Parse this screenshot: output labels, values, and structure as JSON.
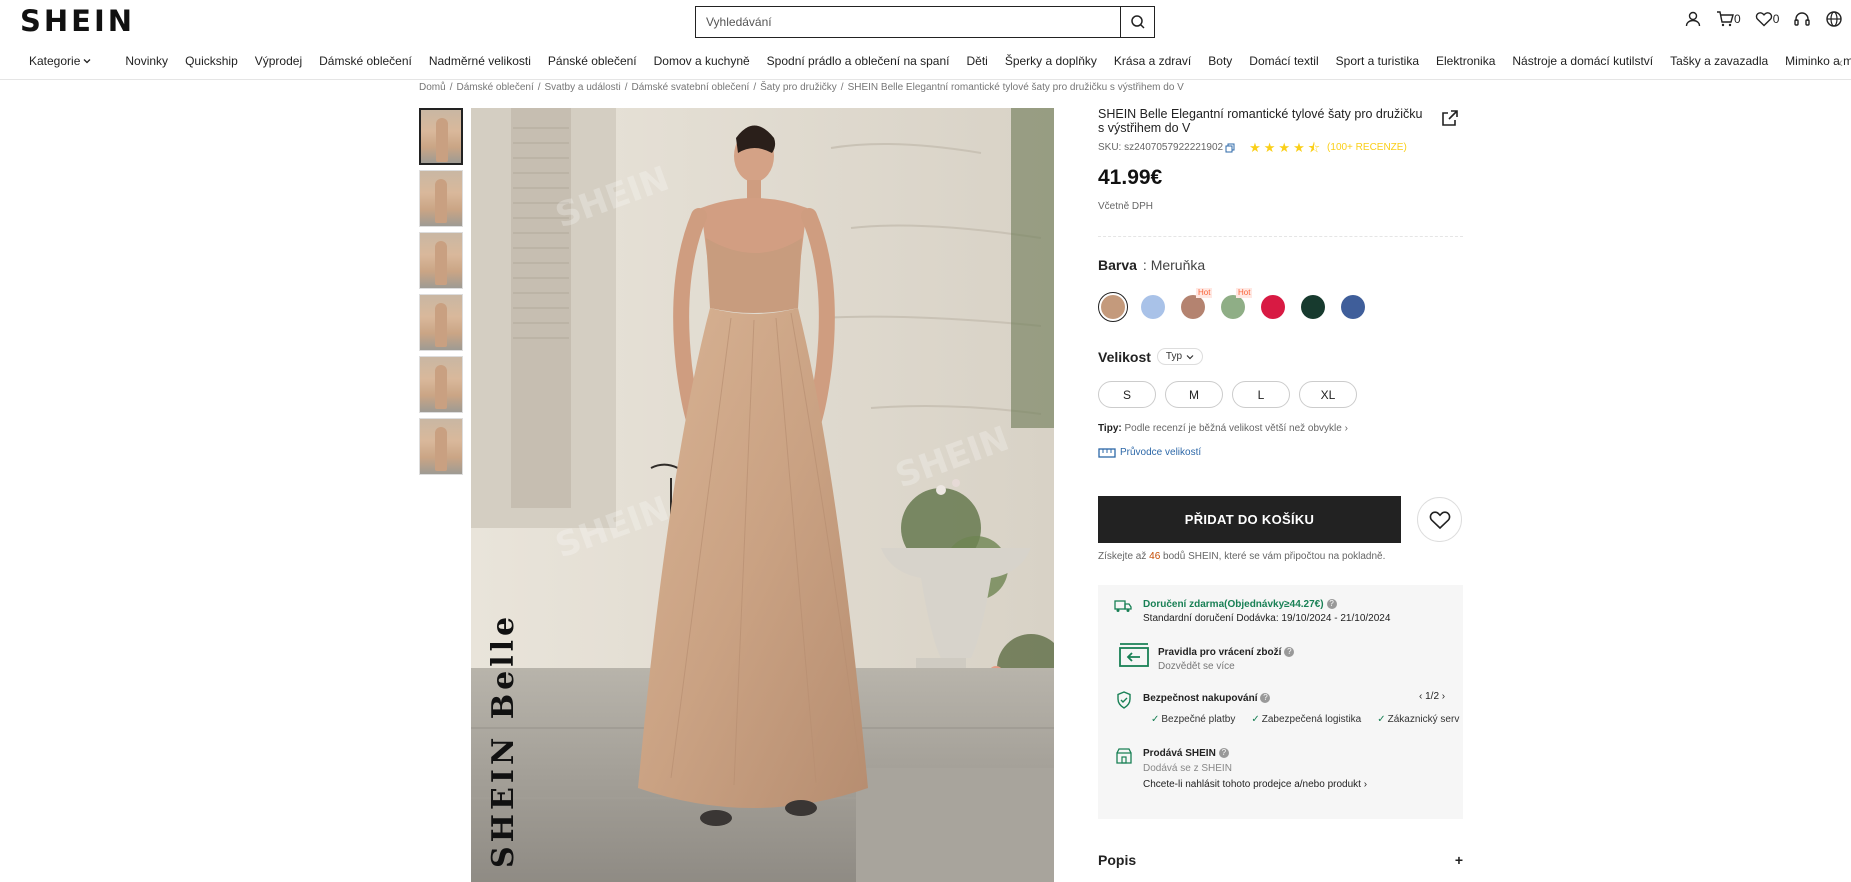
{
  "header": {
    "logo": "SHEIN",
    "search_placeholder": "Vyhledávání",
    "cart_count": "0",
    "wishlist_count": "0"
  },
  "nav": {
    "items": [
      "Kategorie",
      "Novinky",
      "Quickship",
      "Výprodej",
      "Dámské oblečení",
      "Nadměrné velikosti",
      "Pánské oblečení",
      "Domov a kuchyně",
      "Spodní prádlo a oblečení na spaní",
      "Děti",
      "Šperky a doplňky",
      "Krása a zdraví",
      "Boty",
      "Domácí textil",
      "Sport a turistika",
      "Elektronika",
      "Nástroje a domácí kutilství",
      "Tašky a zavazadla",
      "Miminko a ma"
    ]
  },
  "breadcrumb": [
    "Domů",
    "Dámské oblečení",
    "Svatby a události",
    "Dámské svatební oblečení",
    "Šaty pro družičky",
    "SHEIN Belle Elegantní romantické tylové šaty pro družičku s výstřihem do V"
  ],
  "gallery": {
    "watermark": "SHEIN",
    "brand_text": "SHEIN Belle",
    "thumb_count": 6
  },
  "product": {
    "title": "SHEIN Belle Elegantní romantické tylové šaty pro družičku s výstřihem do V",
    "sku": "SKU: sz2407057922221902",
    "rating": 4.5,
    "reviews": "(100+ RECENZE)",
    "price": "41.99€",
    "vat": "Včetně DPH",
    "color_label": "Barva",
    "color_value": ": Meruňka",
    "swatches": [
      {
        "color": "#c49a7c",
        "hot": ""
      },
      {
        "color": "#a9c2e8",
        "hot": ""
      },
      {
        "color": "#b48370",
        "hot": "Hot"
      },
      {
        "color": "#8fae86",
        "hot": "Hot"
      },
      {
        "color": "#d81a43",
        "hot": ""
      },
      {
        "color": "#173a2e",
        "hot": ""
      },
      {
        "color": "#3f5e9a",
        "hot": ""
      }
    ],
    "size_label": "Velikost",
    "size_type": "Typ",
    "sizes": [
      "S",
      "M",
      "L",
      "XL"
    ],
    "tip_label": "Tipy:",
    "tip_text": "Podle recenzí je běžná velikost větší než obvykle",
    "size_guide": "Průvodce velikostí",
    "add_to_cart": "PŘIDAT DO KOŠÍKU",
    "points_pre": "Získejte až",
    "points_num": "46",
    "points_post": "bodů SHEIN, které se vám připočtou na pokladně."
  },
  "info_panel": {
    "shipping_title": "Doručení zdarma(Objednávky≥44.27€)",
    "shipping_detail": "Standardní doručení Dodávka: 19/10/2024 - 21/10/2024",
    "return_title": "Pravidla pro vrácení zboží",
    "return_sub": "Dozvědět se více",
    "security_title": "Bezpečnost nakupování",
    "security_page": "1/2",
    "security_items": [
      "Bezpečné platby",
      "Zabezpečená logistika",
      "Zákaznický serv"
    ],
    "seller_title": "Prodává SHEIN",
    "seller_sub": "Dodává se z SHEIN",
    "seller_report": "Chcete-li nahlásit tohoto prodejce a/nebo produkt"
  },
  "description": {
    "label": "Popis",
    "toggle": "+"
  }
}
